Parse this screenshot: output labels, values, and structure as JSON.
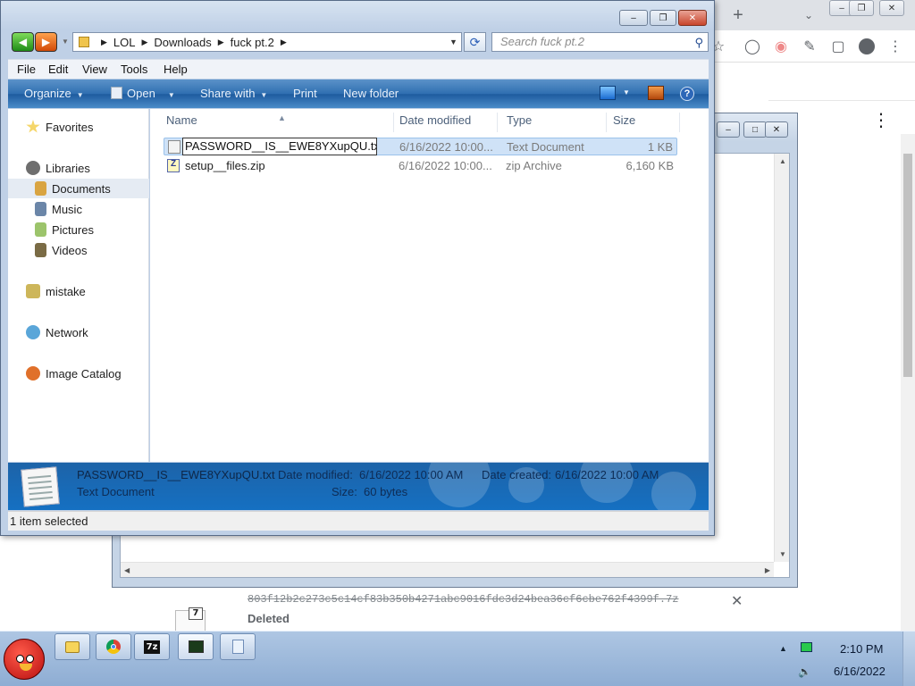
{
  "explorer": {
    "breadcrumb": [
      "LOL",
      "Downloads",
      "fuck pt.2"
    ],
    "search_placeholder": "Search fuck pt.2",
    "menu": [
      "File",
      "Edit",
      "View",
      "Tools",
      "Help"
    ],
    "toolbar": {
      "organize": "Organize",
      "open": "Open",
      "share_with": "Share with",
      "print": "Print",
      "new_folder": "New folder"
    },
    "nav": {
      "favorites": "Favorites",
      "libraries": "Libraries",
      "documents": "Documents",
      "music": "Music",
      "pictures": "Pictures",
      "videos": "Videos",
      "mistake": "mistake",
      "network": "Network",
      "image_catalog": "Image Catalog"
    },
    "columns": {
      "name": "Name",
      "date_modified": "Date modified",
      "type": "Type",
      "size": "Size"
    },
    "files": [
      {
        "name": "PASSWORD__IS__EWE8YXupQU.txt",
        "date": "6/16/2022 10:00...",
        "type": "Text Document",
        "size": "1 KB",
        "renaming": true
      },
      {
        "name": "setup__files.zip",
        "date": "6/16/2022 10:00...",
        "type": "zip Archive",
        "size": "6,160 KB",
        "renaming": false
      }
    ],
    "details": {
      "name": "PASSWORD__IS__EWE8YXupQU.txt",
      "type": "Text Document",
      "date_modified_label": "Date modified:",
      "date_modified": "6/16/2022 10:00 AM",
      "date_created_label": "Date created:",
      "date_created": "6/16/2022 10:00 AM",
      "size_label": "Size:",
      "size": "60 bytes"
    },
    "status": "1 item selected"
  },
  "browser": {
    "download": {
      "filename": "803f12b2c273c5c14cf83b350b4271abc9016fdc3d24bea36cf6cbe762f4399f.7z",
      "status": "Deleted"
    }
  },
  "taskbar": {
    "time": "2:10 PM",
    "date": "6/16/2022"
  },
  "colors": {
    "command_bar": "#2f6fb1",
    "details_pane": "#1570c2",
    "selection": "#cfe2f7",
    "taskbar": "#aec6e3"
  }
}
